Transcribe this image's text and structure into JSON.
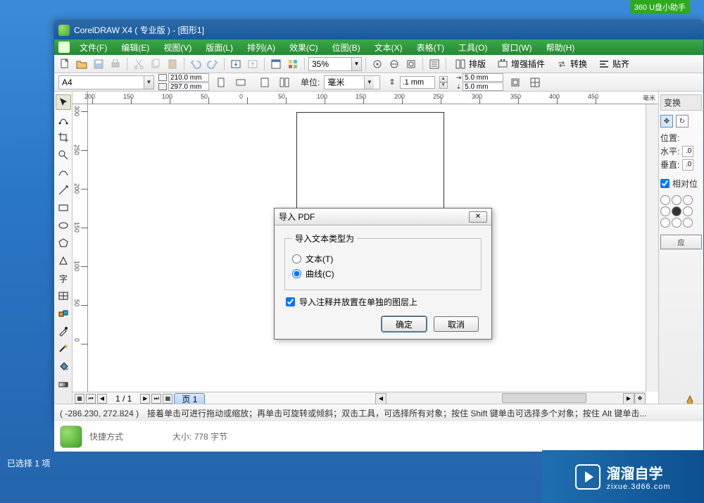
{
  "top_tag": "360 U盘小助手",
  "titlebar": {
    "title": "CorelDRAW X4 ( 专业版 ) - [图形1]"
  },
  "menubar": {
    "items": [
      "文件(F)",
      "编辑(E)",
      "视图(V)",
      "版面(L)",
      "排列(A)",
      "效果(C)",
      "位图(B)",
      "文本(X)",
      "表格(T)",
      "工具(O)",
      "窗口(W)",
      "帮助(H)"
    ]
  },
  "toolbar": {
    "zoom_value": "35%",
    "buttons": {
      "layout": "排版",
      "plugin": "增强插件",
      "convert": "转换",
      "align": "贴齐"
    }
  },
  "propbar": {
    "paper": "A4",
    "width": "210.0 mm",
    "height": "297.0 mm",
    "units_label": "单位:",
    "units_value": "毫米",
    "nudge_value": ".1 mm",
    "dup_x": "5.0 mm",
    "dup_y": "5.0 mm"
  },
  "ruler": {
    "h_ticks": [
      "200",
      "150",
      "100",
      "50",
      "0",
      "50",
      "100",
      "150",
      "200",
      "250",
      "300",
      "350",
      "400",
      "450"
    ],
    "v_ticks": [
      "300",
      "250",
      "200",
      "150",
      "100",
      "50",
      "0"
    ],
    "unit_label": "毫米"
  },
  "pagenav": {
    "counter": "1 / 1",
    "tab_label": "页 1"
  },
  "right_panel": {
    "tab": "变换",
    "pos_label": "位置:",
    "h_label": "水平:",
    "v_label": "垂直:",
    "val": ".0",
    "rel_label": "相对位",
    "apply": "应"
  },
  "statusbar": {
    "coords": "( -286.230, 272.824 )",
    "help": "接着单击可进行拖动或缩放；再单击可旋转或倾斜；双击工具，可选择所有对象；按住 Shift 键单击可选择多个对象；按住 Alt 键单击..."
  },
  "dialog": {
    "title": "导入 PDF",
    "group_label": "导入文本类型为",
    "opt_text": "文本(T)",
    "opt_curve": "曲线(C)",
    "chk_label": "导入注释并放置在单独的图层上",
    "ok": "确定",
    "cancel": "取消"
  },
  "explorer": {
    "line1": "快捷方式",
    "size_label": "大小:",
    "size_value": "778 字节"
  },
  "bottom_text": "已选择 1 项",
  "brand": {
    "big": "溜溜自学",
    "small": "zixue.3d66.com"
  },
  "colors": [
    "none",
    "#000000",
    "#ffffff",
    "#00a651",
    "#8dc63f",
    "#fff200",
    "#f7941d",
    "#ed1c24",
    "#92278f",
    "#2e3192",
    "#00aeef",
    "#662d91",
    "#ec008c",
    "#898989",
    "#c0c0c0",
    "#603913",
    "#8a5d3b",
    "#a67c52",
    "#c69c6d",
    "#006838",
    "#39b54a",
    "#d7df23",
    "#fbb040",
    "#f15a29",
    "#be1e2d",
    "#9e005d",
    "#1b1464",
    "#0054a6"
  ]
}
